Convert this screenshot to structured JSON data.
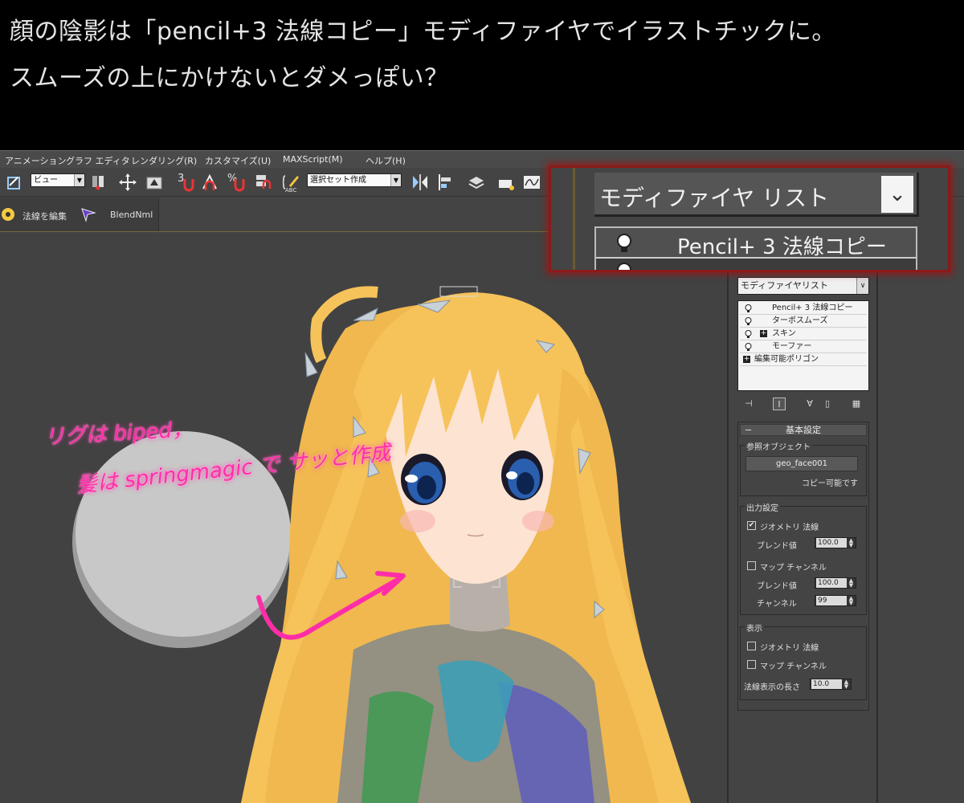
{
  "caption": {
    "line1": "顔の陰影は「pencil+3 法線コピー」モディファイヤでイラストチックに。",
    "line2": "スムーズの上にかけないとダメっぽい？"
  },
  "menubar": {
    "items": [
      "アニメーション",
      "グラフ エディタ",
      "レンダリング(R)",
      "カスタマイズ(U)",
      "MAXScript(M)",
      "ヘルプ(H)"
    ]
  },
  "toolbar": {
    "view_combo": "ビュー",
    "snap_3": "3",
    "snap_percent": "%",
    "selection_set_combo": "選択セット作成",
    "abc_label": "ABC"
  },
  "ribbon": {
    "edit_normals": "法線を編集",
    "blendnml": "BlendNml"
  },
  "annotations": {
    "note1": "リグは biped，",
    "note2": "髪は springmagic で サッと作成"
  },
  "command_panel": {
    "modifier_list": "モディファイヤリスト",
    "stack": [
      {
        "label": "Pencil+ 3 法線コピー",
        "indent": false,
        "expander": false
      },
      {
        "label": "ターボスムーズ",
        "indent": false,
        "expander": false
      },
      {
        "label": "スキン",
        "indent": true,
        "expander": true
      },
      {
        "label": "モーファー",
        "indent": false,
        "expander": false
      },
      {
        "label": "編集可能ポリゴン",
        "indent": false,
        "expander": true
      }
    ],
    "rollout_title": "基本設定",
    "rollout_minus": "−",
    "ref_group": "参照オブジェクト",
    "ref_object": "geo_face001",
    "copyable": "コピー可能です",
    "output_group": "出力設定",
    "geo_normal": "ジオメトリ 法線",
    "geo_normal_checked": true,
    "blend_label": "ブレンド値",
    "blend_value_1": "100.0",
    "map_channel": "マップ チャンネル",
    "map_channel_checked": false,
    "blend_value_2": "100.0",
    "channel_label": "チャンネル",
    "channel_value": "99",
    "display_group": "表示",
    "disp_geo_normal": "ジオメトリ 法線",
    "disp_map_channel": "マップ チャンネル",
    "normal_length_label": "法線表示の長さ",
    "normal_length_value": "10.0",
    "check_mark": "✔"
  },
  "zoom_callout": {
    "modifier_list": "モディファイヤ リスト",
    "stack_item": "Pencil+ 3 法線コピー",
    "arrow": "⌄"
  },
  "colors": {
    "annotation_pink": "#ff2ea8",
    "callout_red": "#8b1a1a",
    "hair": "#f6c35a",
    "panel_bg": "#444444"
  }
}
